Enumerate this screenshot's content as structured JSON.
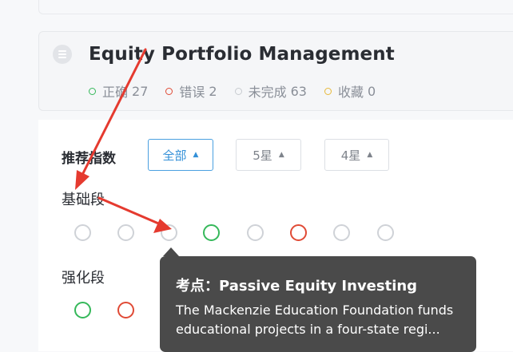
{
  "header": {
    "title": "Equity Portfolio Management",
    "stats": [
      {
        "label": "正确",
        "count": "27",
        "color": "#35b85a"
      },
      {
        "label": "错误",
        "count": "2",
        "color": "#e04a35"
      },
      {
        "label": "未完成",
        "count": "63",
        "color": "#c8cbd0"
      },
      {
        "label": "收藏",
        "count": "0",
        "color": "#e8b93a"
      }
    ]
  },
  "filters": {
    "label": "推荐指数",
    "options": [
      "全部",
      "5星",
      "4星"
    ],
    "active": "全部"
  },
  "sections": [
    {
      "label": "基础段",
      "items": [
        "unanswered",
        "unanswered",
        "unanswered",
        "correct",
        "unanswered",
        "wrong",
        "unanswered",
        "unanswered"
      ]
    },
    {
      "label": "强化段",
      "items": [
        "correct",
        "wrong",
        "correct",
        "unanswered",
        "unanswered",
        "correct",
        "unanswered"
      ]
    }
  ],
  "tooltip": {
    "title": "考点：Passive Equity Investing",
    "body": "The Mackenzie Education Foundation funds educational projects in a four-state regi..."
  },
  "colors": {
    "accent": "#3390d8",
    "annotation_arrow": "#e53a2f"
  }
}
